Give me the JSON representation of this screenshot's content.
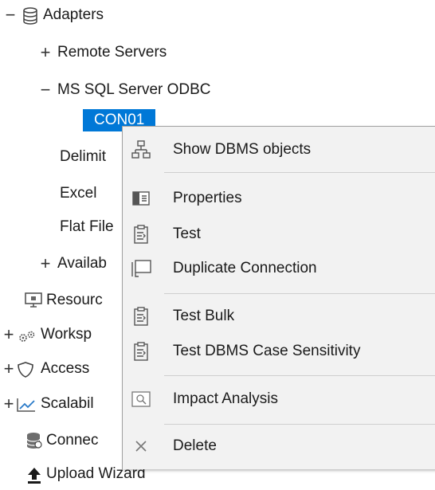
{
  "tree": {
    "adapters": {
      "label": "Adapters",
      "expander": "−",
      "icon": "database-icon"
    },
    "remote_servers": {
      "label": "Remote Servers",
      "expander": "+"
    },
    "ms_sql": {
      "label": "MS SQL Server ODBC",
      "expander": "−"
    },
    "con01": {
      "label": "CON01"
    },
    "delimited": {
      "label": "Delimit"
    },
    "excel": {
      "label": "Excel"
    },
    "flat_file": {
      "label": "Flat File"
    },
    "available": {
      "label": "Availab",
      "expander": "+"
    },
    "resources": {
      "label": "Resourc",
      "icon": "monitor-icon"
    },
    "workspace": {
      "label": "Worksp",
      "expander": "+",
      "icon": "gears-icon"
    },
    "access": {
      "label": "Access",
      "expander": "+",
      "icon": "shield-icon"
    },
    "scalability": {
      "label": "Scalabil",
      "expander": "+",
      "icon": "chart-icon"
    },
    "connections": {
      "label": "Connec",
      "icon": "db-gear-icon"
    },
    "upload_wizard": {
      "label": "Upload Wizard",
      "icon": "upload-arrow-icon"
    }
  },
  "context_menu": {
    "items": [
      {
        "label": "Show DBMS objects",
        "icon": "hierarchy-icon"
      },
      {
        "label": "Properties",
        "icon": "properties-icon"
      },
      {
        "label": "Test",
        "icon": "clipboard-icon"
      },
      {
        "label": "Duplicate Connection",
        "icon": "duplicate-icon"
      },
      {
        "label": "Test Bulk",
        "icon": "clipboard-icon"
      },
      {
        "label": "Test DBMS Case Sensitivity",
        "icon": "clipboard-icon"
      },
      {
        "label": "Impact Analysis",
        "icon": "search-window-icon"
      },
      {
        "label": "Delete",
        "icon": "close-icon"
      }
    ]
  },
  "colors": {
    "selection": "#0078d7",
    "menu_bg": "#f2f2f2"
  }
}
